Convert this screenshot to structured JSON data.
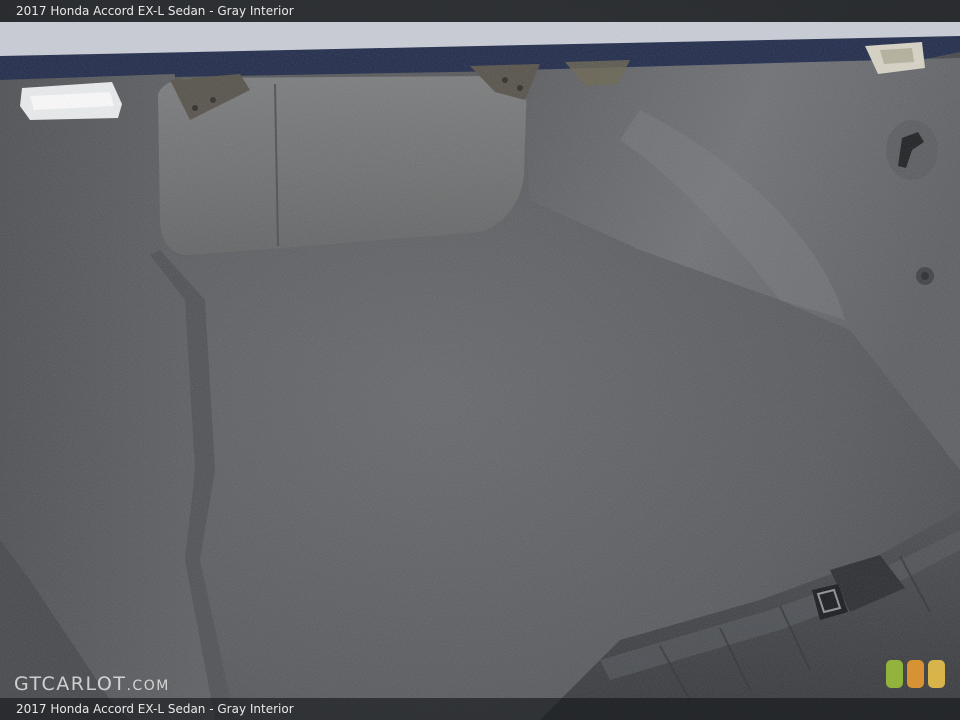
{
  "caption": {
    "top_text": "2017 Honda Accord EX-L Sedan - Gray Interior",
    "bottom_text": "2017 Honda Accord EX-L Sedan - Gray Interior"
  },
  "watermark": {
    "main": "GTCARLOT",
    "suffix": ".COM"
  },
  "colors": {
    "carpet": "#5b5d61",
    "carpet_dark": "#4b4d51",
    "trim_plastic": "#3e4044",
    "body_paint": "#1f2a4a",
    "brand_green": "#9fc73a",
    "brand_orange": "#f0a030",
    "brand_yellow": "#f2c84a"
  },
  "icons": {
    "trunk_light": "trunk-light-icon",
    "latch": "trunk-latch-icon",
    "hook": "cargo-hook-icon",
    "brand_logo": "gtcarlot-logo-icon"
  }
}
